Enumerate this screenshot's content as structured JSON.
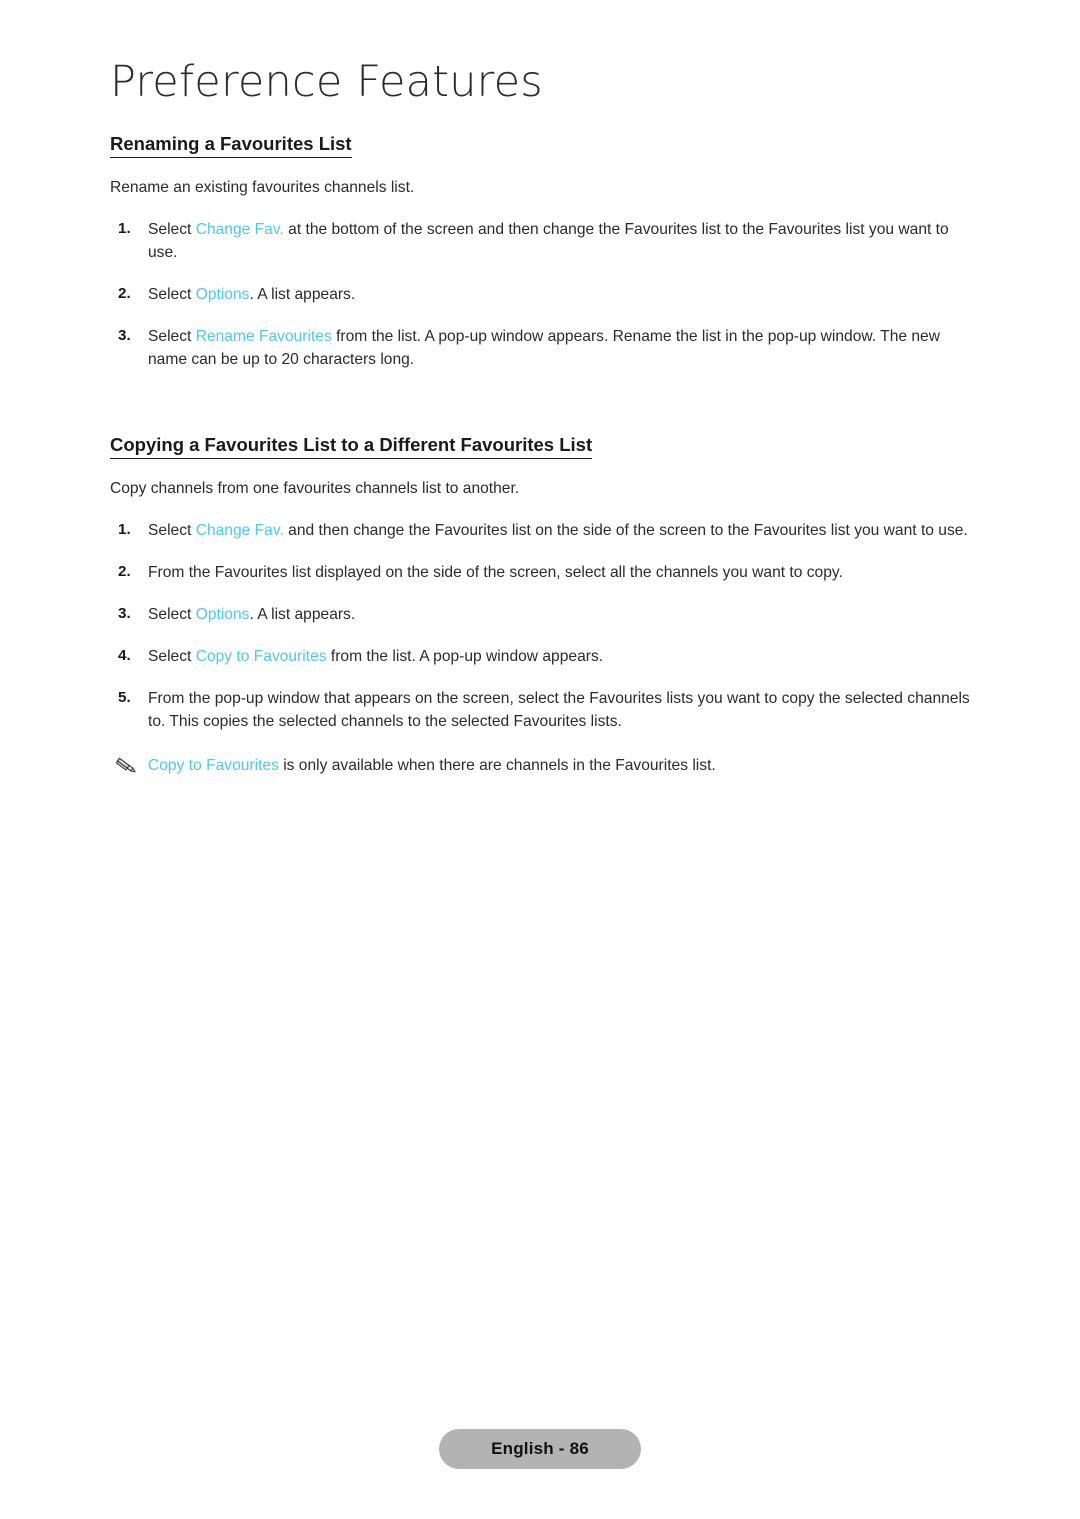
{
  "page": {
    "title": "Preference Features",
    "footer_label": "English - 86",
    "accent_color": "#4dc8f0",
    "text_color": "#2b2b2b",
    "footer_bg": "#b3b3b3"
  },
  "sections": [
    {
      "heading": "Renaming a Favourites List",
      "intro": "Rename an existing favourites channels list.",
      "steps": [
        {
          "num": "1.",
          "parts": [
            {
              "text": "Select ",
              "ui": false
            },
            {
              "text": "Change Fav.",
              "ui": true
            },
            {
              "text": " at the bottom of the screen and then change the Favourites list to the Favourites list you want to use.",
              "ui": false
            }
          ]
        },
        {
          "num": "2.",
          "parts": [
            {
              "text": "Select ",
              "ui": false
            },
            {
              "text": "Options",
              "ui": true
            },
            {
              "text": ". A list appears.",
              "ui": false
            }
          ]
        },
        {
          "num": "3.",
          "parts": [
            {
              "text": "Select ",
              "ui": false
            },
            {
              "text": "Rename Favourites",
              "ui": true
            },
            {
              "text": " from the list. A pop-up window appears. Rename the list in the pop-up window. The new name can be up to 20 characters long.",
              "ui": false
            }
          ]
        }
      ],
      "note": null
    },
    {
      "heading": "Copying a Favourites List to a Different Favourites List",
      "intro": "Copy channels from one favourites channels list to another.",
      "steps": [
        {
          "num": "1.",
          "parts": [
            {
              "text": "Select ",
              "ui": false
            },
            {
              "text": "Change Fav.",
              "ui": true
            },
            {
              "text": " and then change the Favourites list on the side of the screen to the Favourites list you want to use.",
              "ui": false
            }
          ]
        },
        {
          "num": "2.",
          "parts": [
            {
              "text": "From the Favourites list displayed on the side of the screen, select all the channels you want to copy.",
              "ui": false
            }
          ]
        },
        {
          "num": "3.",
          "parts": [
            {
              "text": "Select ",
              "ui": false
            },
            {
              "text": "Options",
              "ui": true
            },
            {
              "text": ". A list appears.",
              "ui": false
            }
          ]
        },
        {
          "num": "4.",
          "parts": [
            {
              "text": "Select ",
              "ui": false
            },
            {
              "text": "Copy to Favourites",
              "ui": true
            },
            {
              "text": " from the list. A pop-up window appears.",
              "ui": false
            }
          ]
        },
        {
          "num": "5.",
          "parts": [
            {
              "text": "From the pop-up window that appears on the screen, select the Favourites lists you want to copy the selected channels to. This copies the selected channels to the selected Favourites lists.",
              "ui": false
            }
          ]
        }
      ],
      "note": {
        "icon": "pencil-icon",
        "parts": [
          {
            "text": "Copy to Favourites",
            "ui": true
          },
          {
            "text": " is only available when there are channels in the Favourites list.",
            "ui": false
          }
        ]
      }
    }
  ]
}
